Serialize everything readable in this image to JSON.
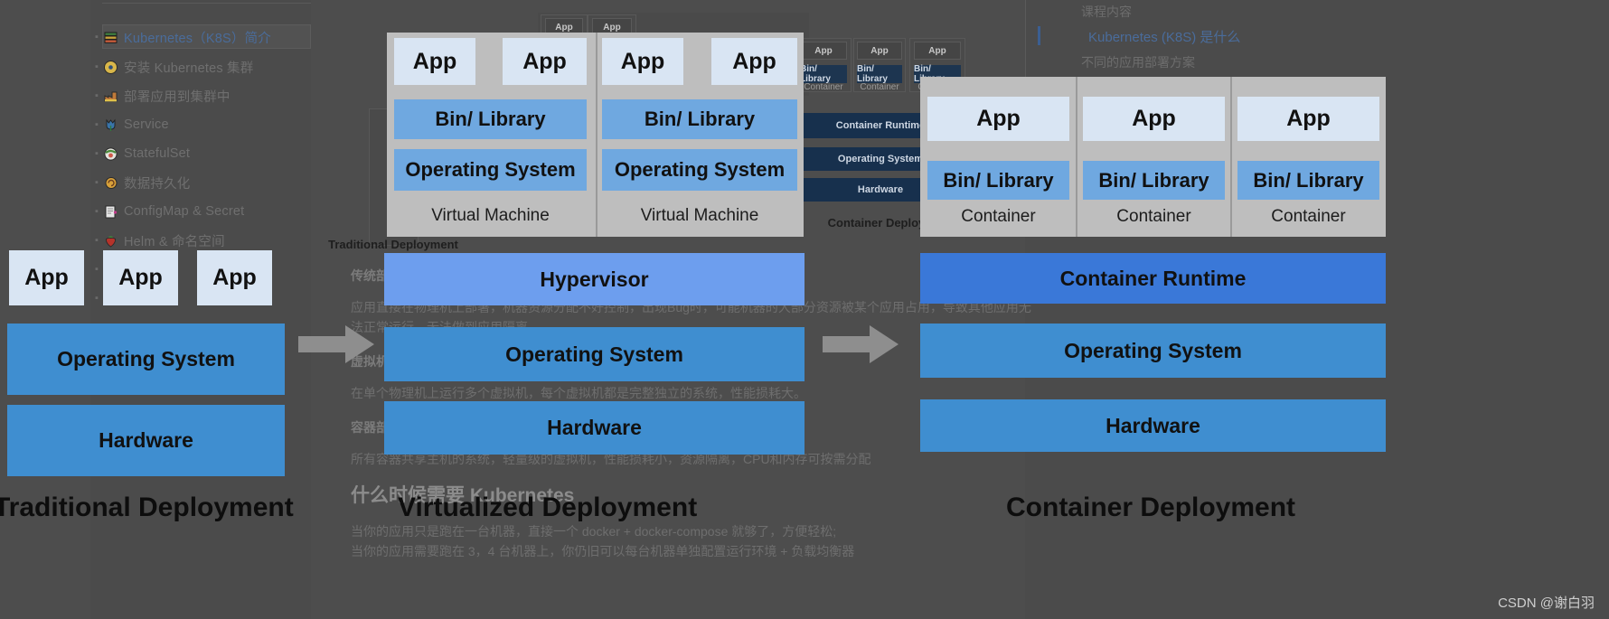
{
  "watermark": "CSDN @谢白羽",
  "left_toc": {
    "items": [
      {
        "label": "Kubernetes（K8S）简介",
        "icon": "books-icon",
        "active": true
      },
      {
        "label": "安装 Kubernetes 集群",
        "icon": "compact-disc-icon",
        "active": false
      },
      {
        "label": "部署应用到集群中",
        "icon": "factory-icon",
        "active": false
      },
      {
        "label": "Service",
        "icon": "tulip-icon",
        "active": false
      },
      {
        "label": "StatefulSet",
        "icon": "sushi-icon",
        "active": false
      },
      {
        "label": "数据持久化",
        "icon": "snail-icon",
        "active": false
      },
      {
        "label": "ConfigMap & Secret",
        "icon": "page-icon",
        "active": false
      },
      {
        "label": "Helm & 命名空间",
        "icon": "strawberry-icon",
        "active": false
      }
    ]
  },
  "right_toc": {
    "heading": "课程内容",
    "items": [
      {
        "label": "Kubernetes (K8S) 是什么",
        "active": true
      },
      {
        "label": "不同的应用部署方案",
        "active": false
      }
    ]
  },
  "article": {
    "blocks": [
      {
        "type": "strong",
        "text": "传统部署"
      },
      {
        "type": "p",
        "text": "应用直接在物理机上部署，机器资源分配不好控制，出现Bug时，可能机器的大部分资源被某个应用占用，导致其他应用无"
      },
      {
        "type": "p",
        "text": "法正常运行，无法做到应用隔离。"
      },
      {
        "type": "strong",
        "text": "虚拟机部署"
      },
      {
        "type": "p",
        "text": "在单个物理机上运行多个虚拟机，每个虚拟机都是完整独立的系统，性能损耗大。"
      },
      {
        "type": "strong",
        "text": "容器部署"
      },
      {
        "type": "p",
        "text": "所有容器共享主机的系统，轻量级的虚拟机，性能损耗小，资源隔离，CPU和内存可按需分配"
      },
      {
        "type": "head",
        "text": "什么时候需要 Kubernetes"
      },
      {
        "type": "p",
        "text": "当你的应用只是跑在一台机器，直接一个 docker + docker-compose 就够了，方便轻松;"
      },
      {
        "type": "p",
        "text": "当你的应用需要跑在 3，4 台机器上，你仍旧可以每台机器单独配置运行环境 + 负载均衡器"
      }
    ]
  },
  "slide": {
    "traditional": {
      "title": "Traditional Deployment",
      "apps": [
        "App",
        "App",
        "App"
      ],
      "layers": [
        "Operating System",
        "Hardware"
      ]
    },
    "virtualized": {
      "title": "Virtualized Deployment",
      "vms": [
        {
          "apps": [
            "App",
            "App"
          ],
          "bin": "Bin/ Library",
          "os": "Operating System",
          "caption": "Virtual Machine"
        },
        {
          "apps": [
            "App",
            "App"
          ],
          "bin": "Bin/ Library",
          "os": "Operating System",
          "caption": "Virtual Machine"
        }
      ],
      "layers": [
        "Hypervisor",
        "Operating System",
        "Hardware"
      ]
    },
    "container": {
      "title": "Container Deployment",
      "containers": [
        {
          "app": "App",
          "bin": "Bin/ Library",
          "caption": "Container"
        },
        {
          "app": "App",
          "bin": "Bin/ Library",
          "caption": "Container"
        },
        {
          "app": "App",
          "bin": "Bin/ Library",
          "caption": "Container"
        }
      ],
      "layers": [
        "Container Runtime",
        "Operating System",
        "Hardware"
      ]
    }
  },
  "mini_slide": {
    "traditional_title": "Traditional Deployment",
    "container_title": "Container Deployment",
    "app": "App",
    "bin": "Bin/ Library",
    "container_caption": "Container",
    "container_runtime": "Container Runtime",
    "operating_system": "Operating System",
    "hardware": "Hardware"
  },
  "colors": {
    "app_fill": "#d9e5f3",
    "bin_fill": "#6fa8e0",
    "os_fill": "#3f8ed0",
    "hypervisor_fill": "#6d9eee",
    "runtime_fill": "#3a78d8",
    "group_fill": "#bebebe",
    "dim_backdrop": "#4d4d4d",
    "link_blue": "#4a6c9b"
  }
}
